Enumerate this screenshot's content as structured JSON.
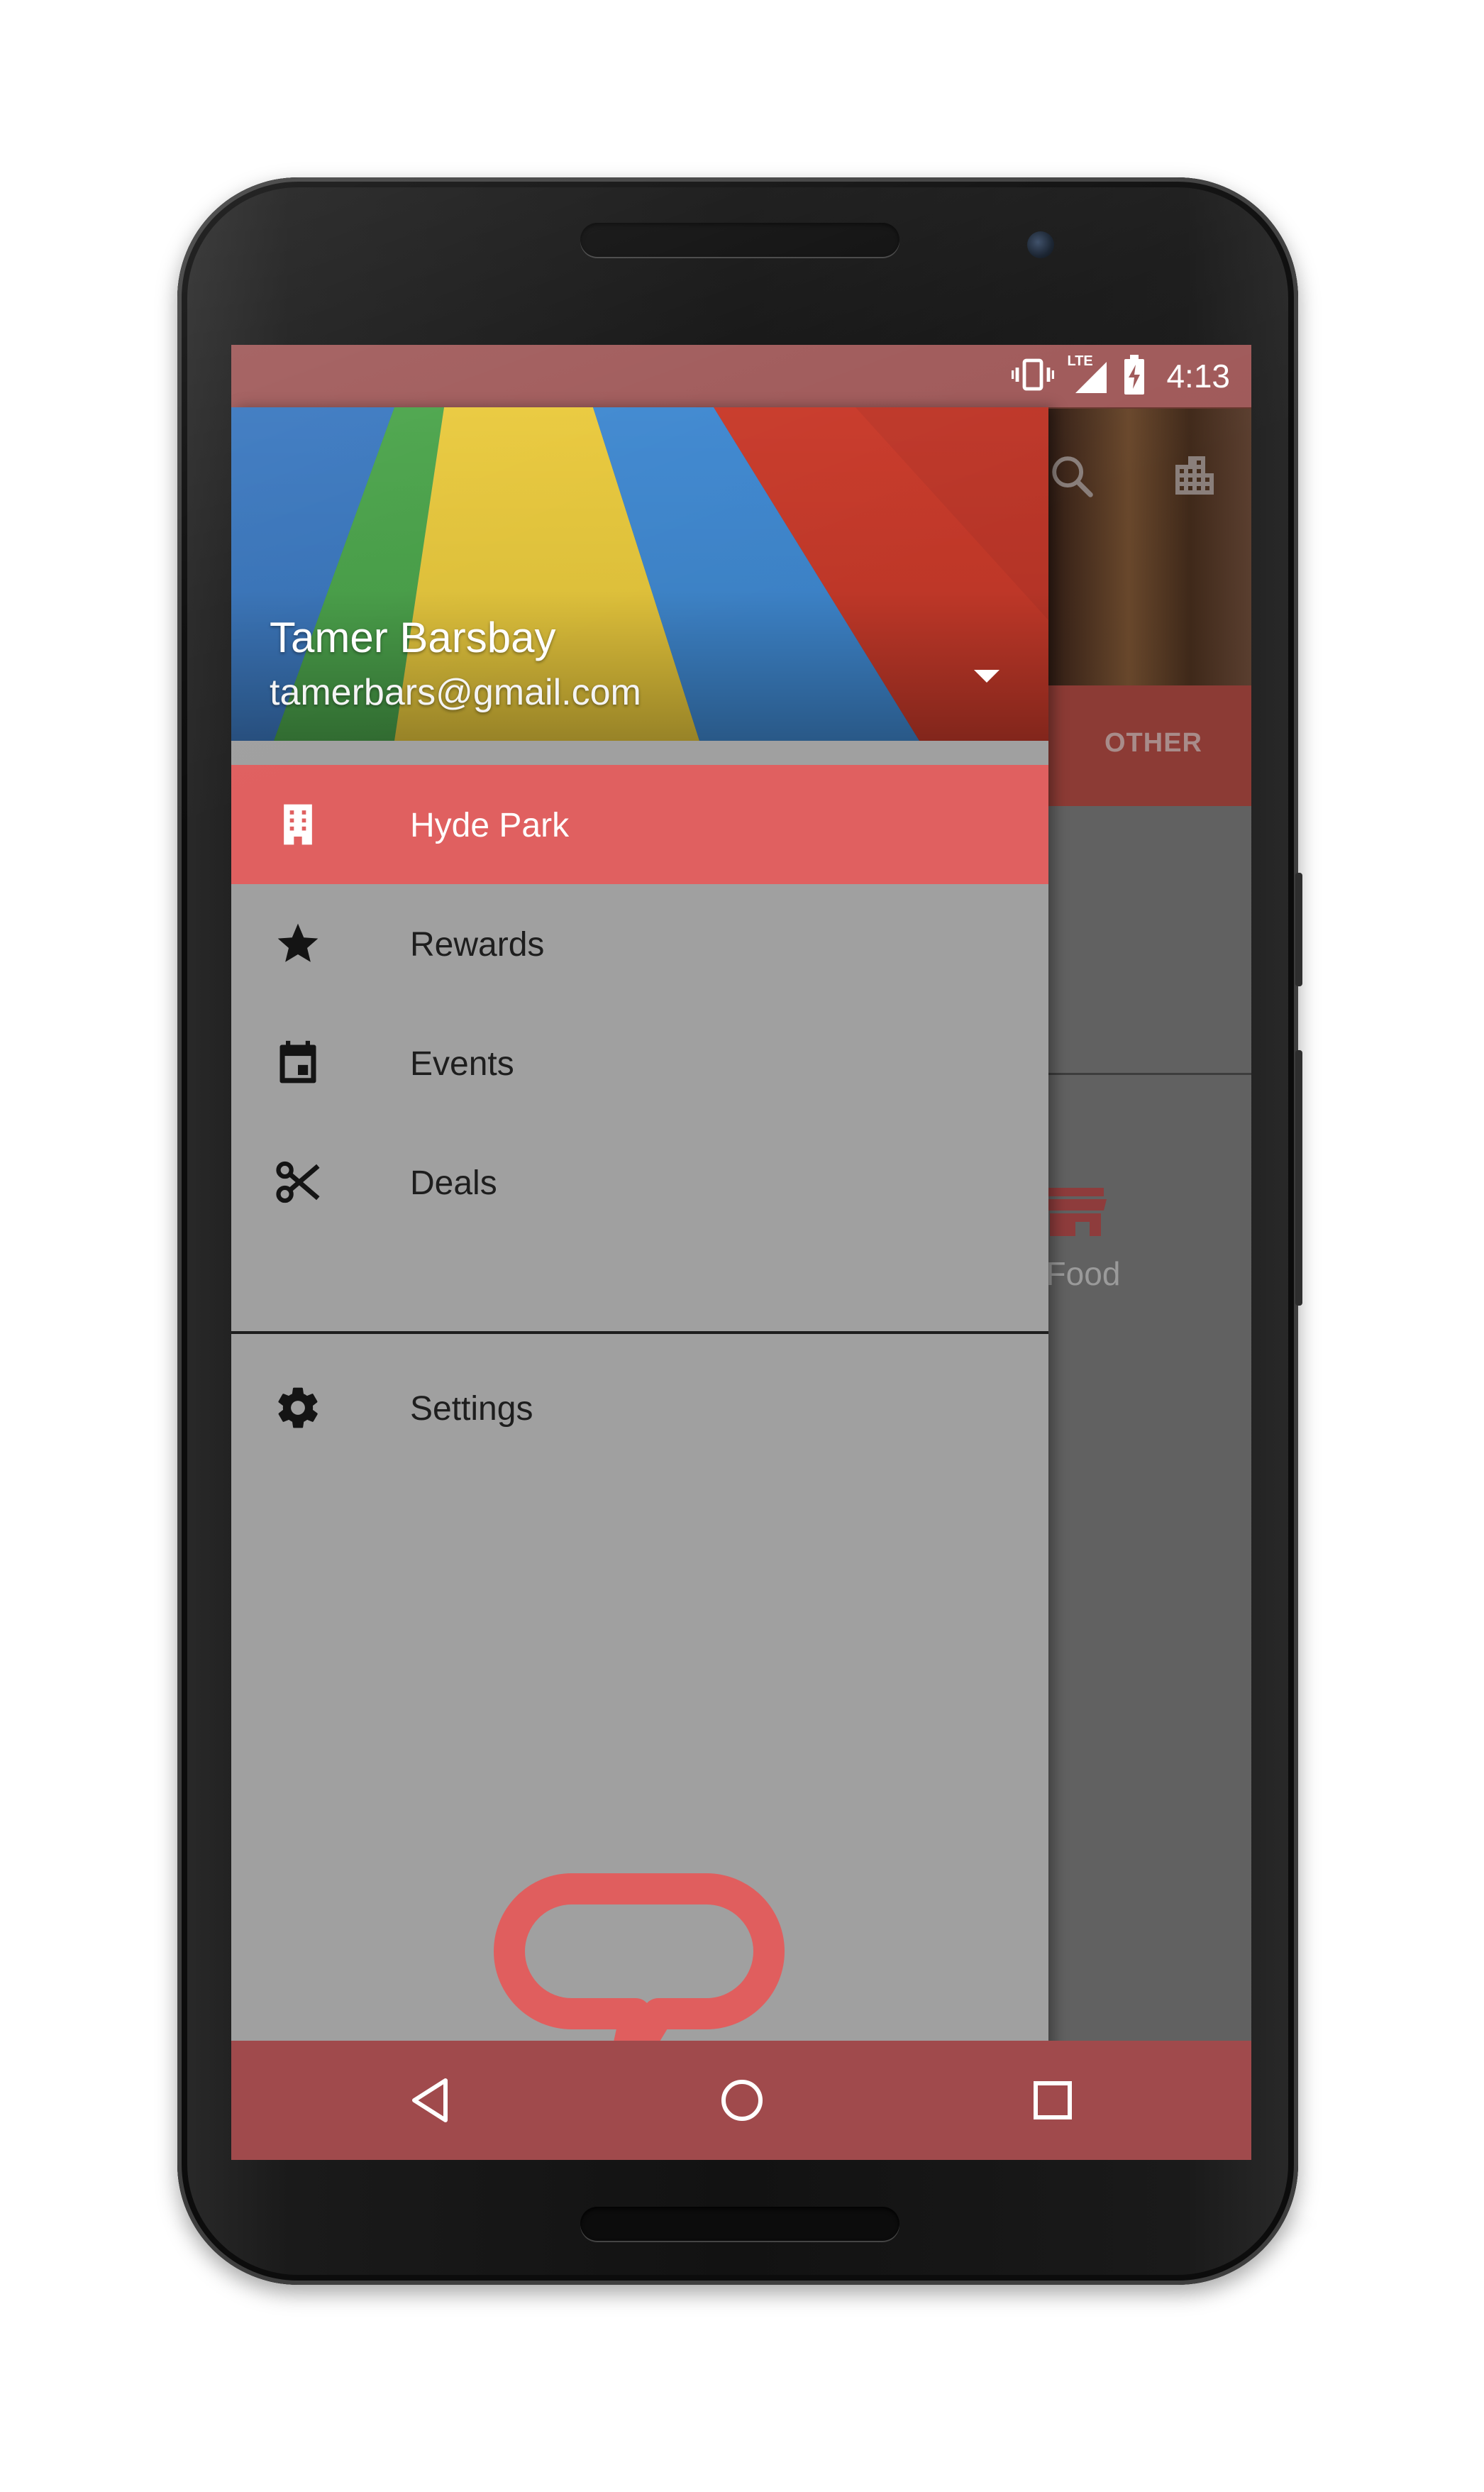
{
  "status_bar": {
    "time": "4:13",
    "icons": [
      "vibrate-icon",
      "lte-signal-icon",
      "battery-charging-icon"
    ],
    "network_label": "LTE"
  },
  "background_app": {
    "tab_other_label": "OTHER",
    "category_label": "st Food",
    "icons": [
      "search-icon",
      "building-icon",
      "store-icon"
    ]
  },
  "drawer": {
    "user": {
      "name": "Tamer Barsbay",
      "email": "tamerbars@gmail.com"
    },
    "items": [
      {
        "label": "Hyde Park",
        "icon": "building-icon",
        "active": true
      },
      {
        "label": "Rewards",
        "icon": "star-icon",
        "active": false
      },
      {
        "label": "Events",
        "icon": "calendar-icon",
        "active": false
      },
      {
        "label": "Deals",
        "icon": "scissors-icon",
        "active": false
      }
    ],
    "secondary_items": [
      {
        "label": "Settings",
        "icon": "gear-icon"
      }
    ],
    "brand_logo": "speech-bubble-logo"
  },
  "navigation_bar": {
    "buttons": [
      "back-icon",
      "home-icon",
      "recents-icon"
    ]
  },
  "colors": {
    "accent": "#e06060",
    "status_bar": "#a05a5a",
    "nav_bar": "#a04a4c",
    "drawer_bg": "#a0a0a0"
  }
}
